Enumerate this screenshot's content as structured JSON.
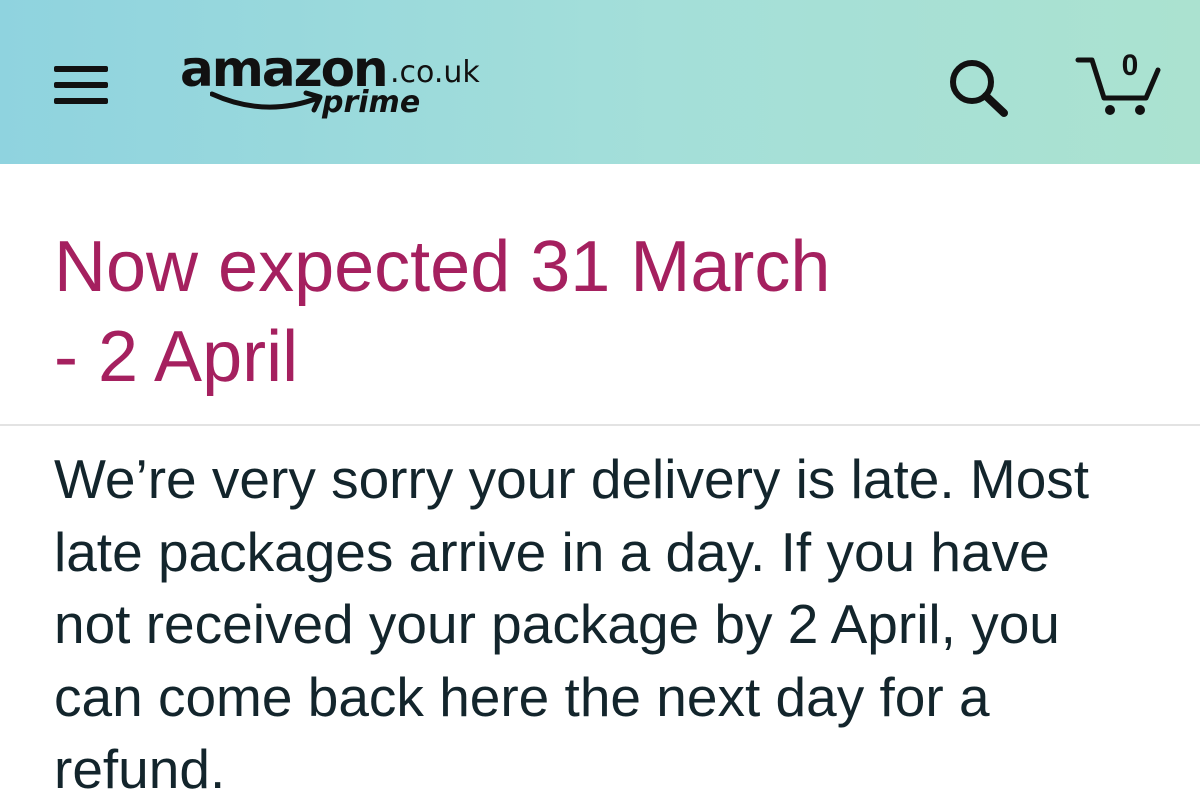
{
  "header": {
    "logo": {
      "wordmark": "amazon",
      "domain": ".co.uk",
      "tier": "prime"
    },
    "menu_icon": "hamburger-menu-icon",
    "search_icon": "search-icon",
    "cart": {
      "icon": "cart-icon",
      "count": "0"
    },
    "colors": {
      "gradient_start": "#8fd3df",
      "gradient_end": "#abe2d0"
    }
  },
  "delivery": {
    "status_lines": [
      "Now expected 31 March",
      "- 2 April"
    ],
    "status_color": "#a5205f"
  },
  "message": {
    "lines": [
      "We’re very sorry your delivery is late. Most",
      "late packages arrive in a day. If you have",
      "not received your package by 2 April, you",
      "can come back here the next day for a",
      "refund."
    ],
    "text_color": "#13252c"
  }
}
